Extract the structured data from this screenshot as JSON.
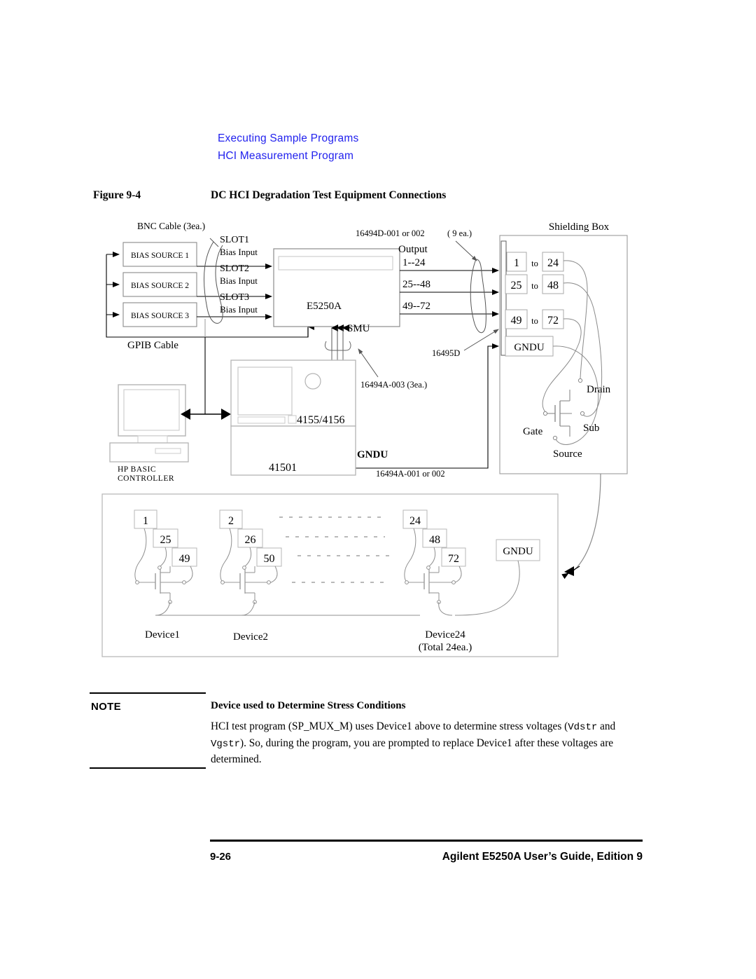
{
  "header": {
    "line1": "Executing Sample Programs",
    "line2": "HCI Measurement Program",
    "color": "#2222ee"
  },
  "figure": {
    "number": "Figure 9-4",
    "title": "DC HCI Degradation Test Equipment Connections"
  },
  "diagram": {
    "bnc_cable_label": "BNC Cable (3ea.)",
    "bias_sources": [
      "BIAS SOURCE 1",
      "BIAS SOURCE 2",
      "BIAS SOURCE 3"
    ],
    "slots": [
      {
        "slot": "SLOT1",
        "input": "Bias Input"
      },
      {
        "slot": "SLOT2",
        "input": "Bias Input"
      },
      {
        "slot": "SLOT3",
        "input": "Bias Input"
      }
    ],
    "mainframe_label": "E5250A",
    "smu_label": "SMU",
    "gpib_cable_label": "GPIB Cable",
    "controller": {
      "line1": "HP BASIC",
      "line2": "CONTROLLER"
    },
    "analyzer": {
      "top_label": "4155/4156",
      "bottom_label": "41501"
    },
    "gndu_analyzer_label": "GNDU",
    "cable_16494A_003": "16494A-003   (3ea.)",
    "cable_16494A_001": "16494A-001 or 002",
    "cable_16494D": "16494D-001 or 002",
    "cable_16494D_count": "( 9 ea.)",
    "cable_16495D": "16495D",
    "outputs": {
      "title": "Output",
      "ranges": [
        "1--24",
        "25--48",
        "49--72"
      ]
    },
    "shielding_box": {
      "title": "Shielding Box",
      "rows": [
        {
          "from": "1",
          "to_label": "to",
          "to": "24"
        },
        {
          "from": "25",
          "to_label": "to",
          "to": "48"
        },
        {
          "from": "49",
          "to_label": "to",
          "to": "72"
        }
      ],
      "gndu_label": "GNDU",
      "terminals": {
        "drain": "Drain",
        "gate": "Gate",
        "sub": "Sub",
        "source": "Source"
      }
    },
    "device_panel": {
      "devices": [
        {
          "name": "Device1",
          "pins": [
            "1",
            "25",
            "49"
          ]
        },
        {
          "name": "Device2",
          "pins": [
            "2",
            "26",
            "50"
          ]
        },
        {
          "name": "Device24",
          "pins": [
            "24",
            "48",
            "72"
          ]
        }
      ],
      "total_label": "(Total 24ea.)",
      "gndu_label": "GNDU"
    }
  },
  "note": {
    "label": "NOTE",
    "heading": "Device used to Determine Stress Conditions",
    "body_part1": "HCI test program (SP_MUX_M) uses Device1 above to determine stress voltages (",
    "body_mono1": "Vdstr",
    "body_part2": " and ",
    "body_mono2": "Vgstr",
    "body_part3": "). So, during the program, you are prompted to replace Device1 after these voltages are determined."
  },
  "footer": {
    "page_number": "9-26",
    "guide_title": "Agilent E5250A User’s Guide, Edition  9"
  }
}
